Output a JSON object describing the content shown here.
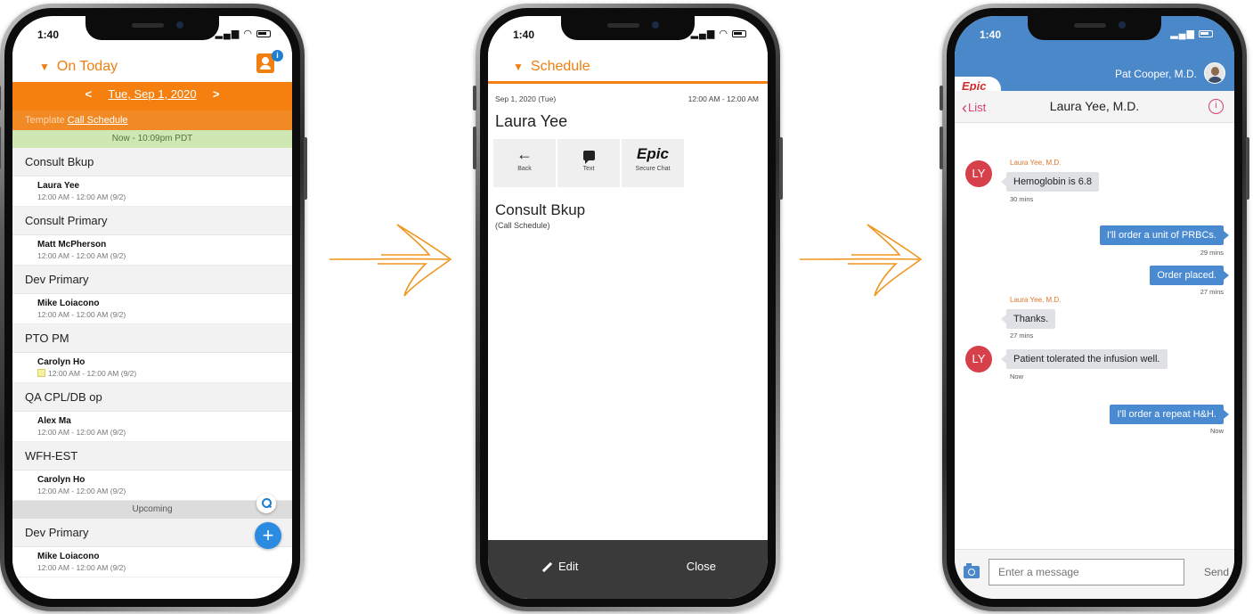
{
  "status": {
    "time": "1:40",
    "phone3_time": "1:40"
  },
  "phone1": {
    "title": "On Today",
    "badge_count": "i",
    "date": "Tue, Sep 1, 2020",
    "prev": "<",
    "next": ">",
    "template_label": "Template",
    "template_value": "Call Schedule",
    "now_bar": "Now - 10:09pm PDT",
    "groups": [
      {
        "section": "Consult Bkup",
        "name": "Laura Yee",
        "time": "12:00 AM - 12:00 AM (9/2)"
      },
      {
        "section": "Consult Primary",
        "name": "Matt McPherson",
        "time": "12:00 AM - 12:00 AM (9/2)"
      },
      {
        "section": "Dev Primary",
        "name": "Mike Loiacono",
        "time": "12:00 AM - 12:00 AM (9/2)"
      },
      {
        "section": "PTO PM",
        "name": "Carolyn Ho",
        "time": "12:00 AM - 12:00 AM (9/2)"
      },
      {
        "section": "QA CPL/DB op",
        "name": "Alex Ma",
        "time": "12:00 AM - 12:00 AM (9/2)"
      },
      {
        "section": "WFH-EST",
        "name": "Carolyn Ho",
        "time": "12:00 AM - 12:00 AM (9/2)"
      }
    ],
    "upcoming_label": "Upcoming",
    "upcoming_group": {
      "section": "Dev Primary",
      "name": "Mike Loiacono",
      "time": "12:00 AM - 12:00 AM (9/2)"
    },
    "fab_add": "+"
  },
  "phone2": {
    "title": "Schedule",
    "date": "Sep 1, 2020 (Tue)",
    "time_range": "12:00 AM - 12:00 AM",
    "name": "Laura Yee",
    "actions": [
      {
        "icon": "←",
        "label": "Back"
      },
      {
        "icon": "chat-bubble",
        "label": "Text"
      },
      {
        "icon": "Epic",
        "label": "Secure Chat"
      }
    ],
    "shift": "Consult Bkup",
    "shift_sub": "(Call Schedule)",
    "edit": "Edit",
    "close": "Close"
  },
  "phone3": {
    "user": "Pat Cooper, M.D.",
    "logo": "Epic",
    "back": "List",
    "chat_title": "Laura Yee, M.D.",
    "info": "i",
    "avatar_initials": "LY",
    "messages": [
      {
        "dir": "in",
        "sender": "Laura Yee, M.D.",
        "text": "Hemoglobin is 6.8",
        "stamp": "30 mins"
      },
      {
        "dir": "out",
        "text": "I'll order a unit of PRBCs.",
        "stamp": "29 mins"
      },
      {
        "dir": "out",
        "text": "Order placed.",
        "stamp": "27 mins"
      },
      {
        "dir": "in",
        "sender": "Laura Yee, M.D.",
        "text": "Thanks.",
        "stamp": "27 mins"
      },
      {
        "dir": "in",
        "text": "Patient tolerated the infusion well.",
        "stamp": "Now"
      },
      {
        "dir": "out",
        "text": "I'll order a repeat H&H.",
        "stamp": "Now"
      }
    ],
    "input_placeholder": "Enter a message",
    "send": "Send"
  },
  "colors": {
    "orange": "#f5800f",
    "epic_blue": "#4a88c9",
    "avatar_red": "#d6404a",
    "arrow": "#f0961e"
  }
}
